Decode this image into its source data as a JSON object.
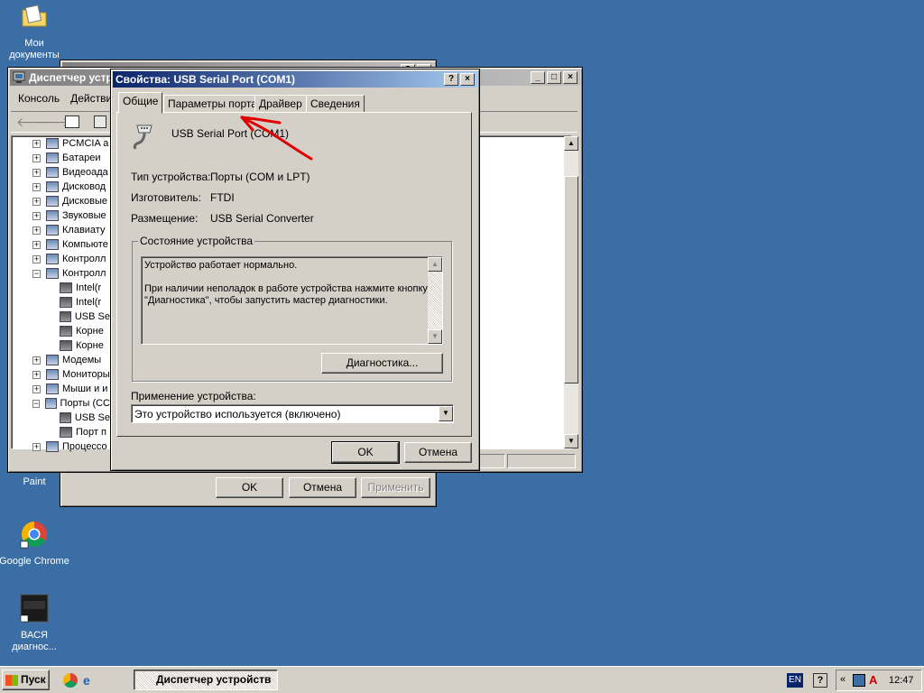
{
  "desktop": {
    "icons": [
      {
        "label": "Мои\nдокументы"
      },
      {
        "label": "Paint"
      },
      {
        "label": "Google Chrome"
      },
      {
        "label": "ВАСЯ\nдиагнос..."
      }
    ]
  },
  "device_manager": {
    "title": "Диспетчер устр",
    "menu": [
      "Консоль",
      "Действи"
    ],
    "tree": [
      {
        "label": "PCMCIA а",
        "expand": "+"
      },
      {
        "label": "Батареи",
        "expand": "+"
      },
      {
        "label": "Видеоада",
        "expand": "+"
      },
      {
        "label": "Дисковод",
        "expand": "+"
      },
      {
        "label": "Дисковые",
        "expand": "+"
      },
      {
        "label": "Звуковые",
        "expand": "+"
      },
      {
        "label": "Клавиату",
        "expand": "+"
      },
      {
        "label": "Компьюте",
        "expand": "+"
      },
      {
        "label": "Контролл",
        "expand": "+"
      },
      {
        "label": "Контролл",
        "expand": "−"
      },
      {
        "label": "Intel(r",
        "child": true
      },
      {
        "label": "Intel(r",
        "child": true
      },
      {
        "label": "USB Se",
        "child": true
      },
      {
        "label": "Корне",
        "child": true
      },
      {
        "label": "Корне",
        "child": true
      },
      {
        "label": "Модемы",
        "expand": "+"
      },
      {
        "label": "Мониторы",
        "expand": "+"
      },
      {
        "label": "Мыши и и",
        "expand": "+"
      },
      {
        "label": "Порты (СС",
        "expand": "−"
      },
      {
        "label": "USB Se",
        "child": true
      },
      {
        "label": "Порт п",
        "child": true
      },
      {
        "label": "Процессо",
        "expand": "+"
      }
    ]
  },
  "back_dialog": {
    "ok": "OK",
    "cancel": "Отмена",
    "apply": "Применить"
  },
  "properties": {
    "title": "Свойства: USB Serial Port (COM1)",
    "tabs": [
      "Общие",
      "Параметры порта",
      "Драйвер",
      "Сведения"
    ],
    "device_name": "USB Serial Port (COM1)",
    "type_label": "Тип устройства:",
    "type_value": "Порты (COM и LPT)",
    "manufacturer_label": "Изготовитель:",
    "manufacturer_value": "FTDI",
    "location_label": "Размещение:",
    "location_value": "USB Serial Converter",
    "status_group": "Состояние устройства",
    "status_line1": "Устройство работает нормально.",
    "status_line2": "При наличии неполадок в работе устройства нажмите кнопку",
    "status_line3": "\"Диагностика\", чтобы запустить мастер диагностики.",
    "diagnostics_button": "Диагностика...",
    "usage_label": "Применение устройства:",
    "usage_value": "Это устройство используется (включено)",
    "ok": "OK",
    "cancel": "Отмена"
  },
  "taskbar": {
    "start": "Пуск",
    "task": "Диспетчер устройств",
    "lang": "EN",
    "clock": "12:47"
  },
  "colors": {
    "desktop": "#3a6ea5",
    "title_active": "#0a246a",
    "annotation_arrow": "#e00000"
  }
}
